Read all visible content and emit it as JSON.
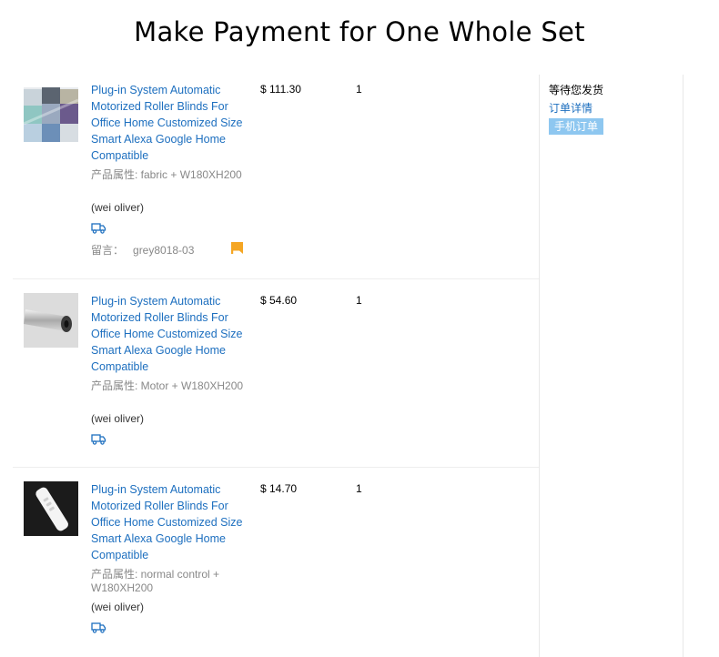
{
  "heading": "Make Payment for One Whole Set",
  "order_status": {
    "status": "等待您发货",
    "detail_link": "订单详情",
    "mobile_badge": "手机订单"
  },
  "items": [
    {
      "title": "Plug-in System Automatic Motorized Roller Blinds For Office Home Customized Size Smart Alexa Google Home Compatible",
      "attributes": "产品属性: fabric + W180XH200",
      "buyer": "(wei oliver)",
      "memo_label": "留言：",
      "memo_value": "grey8018-03",
      "price": "$ 111.30",
      "quantity": "1",
      "thumb_icon": "fabric-swatches-thumbnail"
    },
    {
      "title": "Plug-in System Automatic Motorized Roller Blinds For Office Home Customized Size Smart Alexa Google Home Compatible",
      "attributes": "产品属性: Motor + W180XH200",
      "buyer": "(wei oliver)",
      "price": "$ 54.60",
      "quantity": "1",
      "thumb_icon": "tubular-motor-thumbnail"
    },
    {
      "title": "Plug-in System Automatic Motorized Roller Blinds For Office Home Customized Size Smart Alexa Google Home Compatible",
      "attributes": "产品属性: normal control + W180XH200",
      "buyer": "(wei oliver)",
      "price": "$ 14.70",
      "quantity": "1",
      "thumb_icon": "remote-control-thumbnail"
    }
  ],
  "colors": {
    "link": "#1d6fbf",
    "badge_bg": "#8ec7f0",
    "flag": "#f5a623",
    "muted_text": "#888888"
  }
}
